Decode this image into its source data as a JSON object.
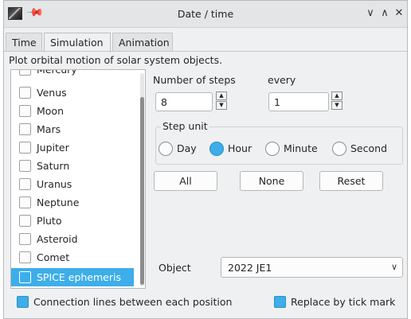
{
  "window": {
    "title": "Date / time",
    "controls": {
      "minimize": "∨",
      "maximize": "∧",
      "close": "✕"
    }
  },
  "tabs": [
    {
      "label": "Time",
      "active": false
    },
    {
      "label": "Simulation",
      "active": true
    },
    {
      "label": "Animation",
      "active": false
    }
  ],
  "description": "Plot orbital motion of solar system objects.",
  "objects_list": {
    "items": [
      {
        "label": "Mercury",
        "checked": false,
        "selected": false
      },
      {
        "label": "Venus",
        "checked": false,
        "selected": false
      },
      {
        "label": "Moon",
        "checked": false,
        "selected": false
      },
      {
        "label": "Mars",
        "checked": false,
        "selected": false
      },
      {
        "label": "Jupiter",
        "checked": false,
        "selected": false
      },
      {
        "label": "Saturn",
        "checked": false,
        "selected": false
      },
      {
        "label": "Uranus",
        "checked": false,
        "selected": false
      },
      {
        "label": "Neptune",
        "checked": false,
        "selected": false
      },
      {
        "label": "Pluto",
        "checked": false,
        "selected": false
      },
      {
        "label": "Asteroid",
        "checked": false,
        "selected": false
      },
      {
        "label": "Comet",
        "checked": false,
        "selected": false
      },
      {
        "label": "SPICE ephemeris",
        "checked": false,
        "selected": true
      }
    ]
  },
  "steps": {
    "label": "Number of steps",
    "value": "8",
    "every_label": "every",
    "every_value": "1"
  },
  "step_unit": {
    "title": "Step unit",
    "options": [
      {
        "label": "Day",
        "checked": false
      },
      {
        "label": "Hour",
        "checked": true
      },
      {
        "label": "Minute",
        "checked": false
      },
      {
        "label": "Second",
        "checked": false
      }
    ]
  },
  "buttons": {
    "all": "All",
    "none": "None",
    "reset": "Reset"
  },
  "object": {
    "label": "Object",
    "value": "2022 JE1"
  },
  "options": {
    "connection_lines": {
      "label": "Connection lines between each position",
      "checked": true
    },
    "tick_mark": {
      "label": "Replace by tick mark",
      "checked": true
    }
  },
  "colors": {
    "accent": "#3daee9",
    "window_bg": "#eff0f1",
    "titlebar_bg": "#e3e5e7"
  }
}
